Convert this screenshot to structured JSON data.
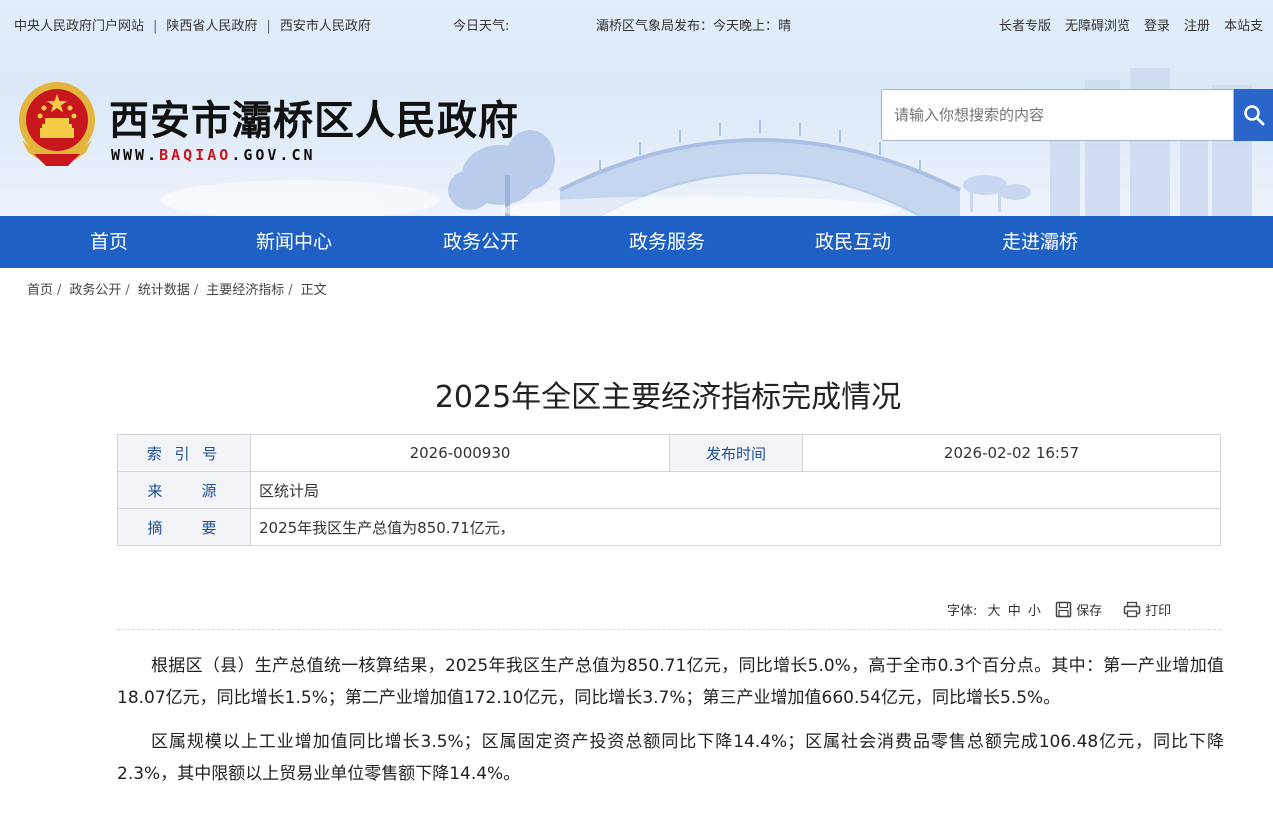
{
  "topbar": {
    "links": [
      "中央人民政府门户网站",
      "陕西省人民政府",
      "西安市人民政府"
    ],
    "weather_label": "今日天气:",
    "forecast": "灞桥区气象局发布：今天晚上：晴",
    "right_links": [
      "长者专版",
      "无障碍浏览",
      "登录",
      "注册",
      "本站支"
    ]
  },
  "header": {
    "site_title": "西安市灞桥区人民政府",
    "url_prefix": "WWW.",
    "url_highlight": "BAQIAO",
    "url_suffix": ".GOV.CN",
    "search_placeholder": "请输入你想搜索的内容"
  },
  "nav": {
    "items": [
      "首页",
      "新闻中心",
      "政务公开",
      "政务服务",
      "政民互动",
      "走进灞桥"
    ]
  },
  "breadcrumb": {
    "items": [
      "首页",
      "政务公开",
      "统计数据",
      "主要经济指标",
      "正文"
    ],
    "separator": "/"
  },
  "article": {
    "title": "2025年全区主要经济指标完成情况",
    "info": {
      "index_label": "索 引 号",
      "index_value": "2026-000930",
      "publish_label": "发布时间",
      "publish_value": "2026-02-02 16:57",
      "source_label": "来    源",
      "source_value": "区统计局",
      "summary_label": "摘    要",
      "summary_value": "2025年我区生产总值为850.71亿元，"
    },
    "tools": {
      "font_label": "字体:",
      "font_large": "大",
      "font_medium": "中",
      "font_small": "小",
      "save": "保存",
      "print": "打印"
    },
    "paragraphs": [
      "根据区（县）生产总值统一核算结果，2025年我区生产总值为850.71亿元，同比增长5.0%，高于全市0.3个百分点。其中：第一产业增加值18.07亿元，同比增长1.5%；第二产业增加值172.10亿元，同比增长3.7%；第三产业增加值660.54亿元，同比增长5.5%。",
      "区属规模以上工业增加值同比增长3.5%；区属固定资产投资总额同比下降14.4%；区属社会消费品零售总额完成106.48亿元，同比下降2.3%，其中限额以上贸易业单位零售额下降14.4%。"
    ]
  },
  "colors": {
    "nav_bg": "#1f60c4",
    "search_button": "#2a66c9",
    "url_highlight": "#c8161d",
    "label_text": "#1f4e99"
  }
}
